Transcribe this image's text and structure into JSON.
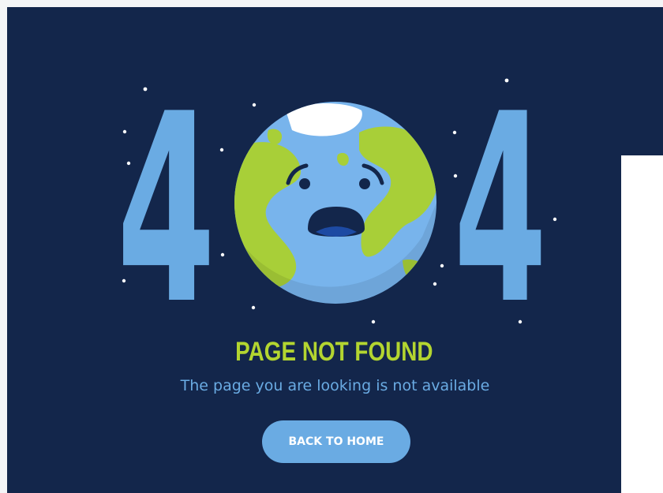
{
  "error": {
    "code_left_digit": "4",
    "code_right_digit": "4",
    "title": "PAGE NOT FOUND",
    "message": "The page you are looking is not available"
  },
  "actions": {
    "back_label": "BACK TO HOME"
  },
  "illustration": {
    "icon": "sad-earth-icon"
  },
  "colors": {
    "background": "#13264b",
    "accent_blue": "#6aabe3",
    "accent_green": "#b3d530",
    "ocean": "#78b4ec",
    "land": "#a8cf38"
  }
}
